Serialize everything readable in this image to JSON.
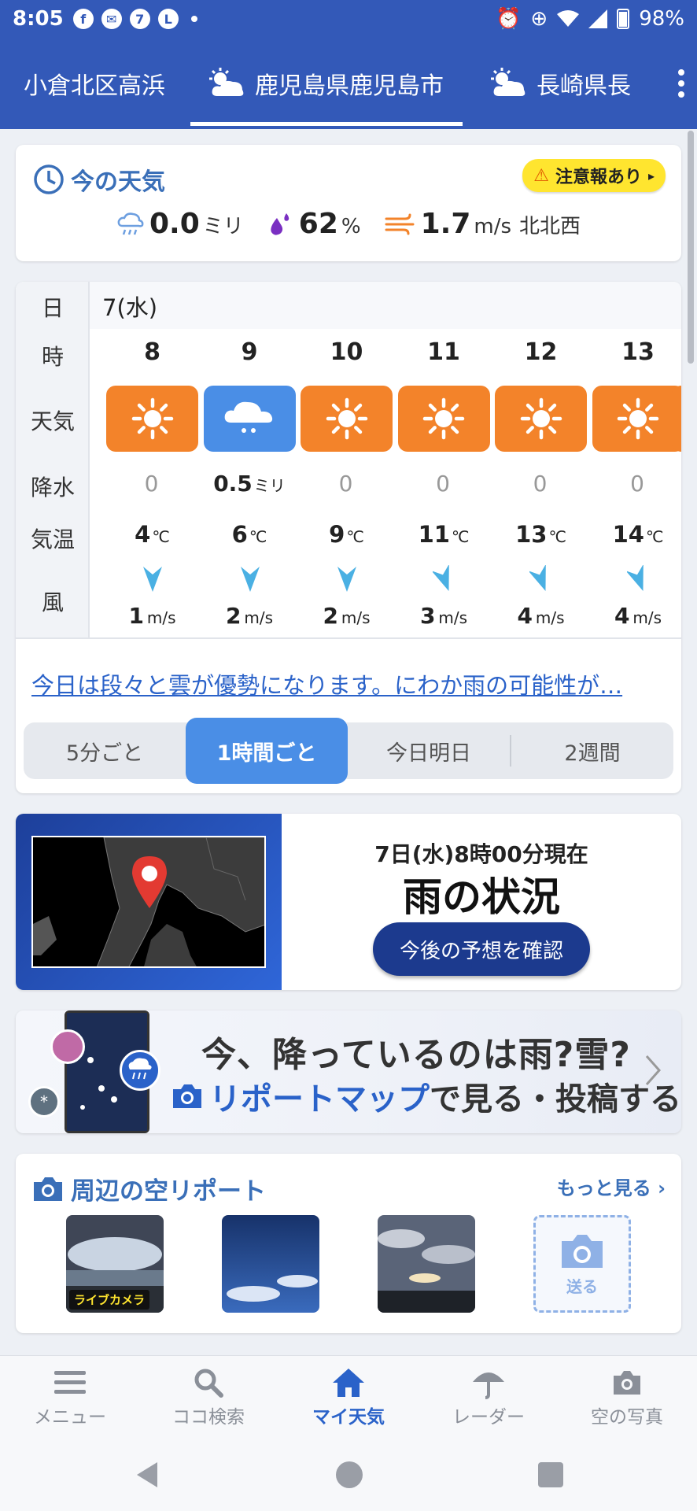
{
  "status_bar": {
    "time": "8:05",
    "battery": "98%"
  },
  "location_tabs": [
    {
      "label": "小倉北区高浜"
    },
    {
      "label": "鹿児島県鹿児島市"
    },
    {
      "label": "長崎県長"
    }
  ],
  "current": {
    "title": "今の天気",
    "alert": "注意報あり",
    "precip": {
      "value": "0.0",
      "unit": "ミリ"
    },
    "humidity": {
      "value": "62",
      "unit": "%"
    },
    "wind": {
      "value": "1.7",
      "unit": "m/s",
      "direction": "北北西"
    }
  },
  "forecast": {
    "labels": {
      "day": "日",
      "hour": "時",
      "weather": "天気",
      "precip": "降水",
      "temp": "気温",
      "wind": "風"
    },
    "date": "7(水)",
    "hours": [
      {
        "hour": "8",
        "weather": "sun-icon",
        "precip": "0",
        "precip_unit": "",
        "temp": "4",
        "temp_unit": "℃",
        "wind": "1",
        "wind_unit": "m/s"
      },
      {
        "hour": "9",
        "weather": "rain-icon",
        "precip": "0.5",
        "precip_unit": "ミリ",
        "temp": "6",
        "temp_unit": "℃",
        "wind": "2",
        "wind_unit": "m/s"
      },
      {
        "hour": "10",
        "weather": "sun-icon",
        "precip": "0",
        "precip_unit": "",
        "temp": "9",
        "temp_unit": "℃",
        "wind": "2",
        "wind_unit": "m/s"
      },
      {
        "hour": "11",
        "weather": "sun-icon",
        "precip": "0",
        "precip_unit": "",
        "temp": "11",
        "temp_unit": "℃",
        "wind": "3",
        "wind_unit": "m/s"
      },
      {
        "hour": "12",
        "weather": "sun-icon",
        "precip": "0",
        "precip_unit": "",
        "temp": "13",
        "temp_unit": "℃",
        "wind": "4",
        "wind_unit": "m/s"
      },
      {
        "hour": "13",
        "weather": "sun-icon",
        "precip": "0",
        "precip_unit": "",
        "temp": "14",
        "temp_unit": "℃",
        "wind": "4",
        "wind_unit": "m/s"
      }
    ],
    "summary": "今日は段々と雲が優勢になります。にわか雨の可能性が…",
    "segments": [
      "5分ごと",
      "1時間ごと",
      "今日明日",
      "2週間"
    ]
  },
  "radar": {
    "time": "7日(水)8時00分現在",
    "title": "雨の状況",
    "button": "今後の予想を確認"
  },
  "promo": {
    "line1": "今、降っているのは雨?雪?",
    "line2_highlight": "リポートマップ",
    "line2_rest": "で見る・投稿する"
  },
  "sky_report": {
    "title": "周辺の空リポート",
    "more": "もっと見る",
    "livecam_badge": "ライブカメラ",
    "send_label": "送る"
  },
  "bottom_nav": [
    {
      "label": "メニュー"
    },
    {
      "label": "ココ検索"
    },
    {
      "label": "マイ天気"
    },
    {
      "label": "レーダー"
    },
    {
      "label": "空の写真"
    }
  ],
  "colors": {
    "header": "#3359b8",
    "accent": "#2a62c9",
    "sun_box": "#f3832a",
    "rain_box": "#4a8ee6",
    "alert": "#ffe52f"
  }
}
